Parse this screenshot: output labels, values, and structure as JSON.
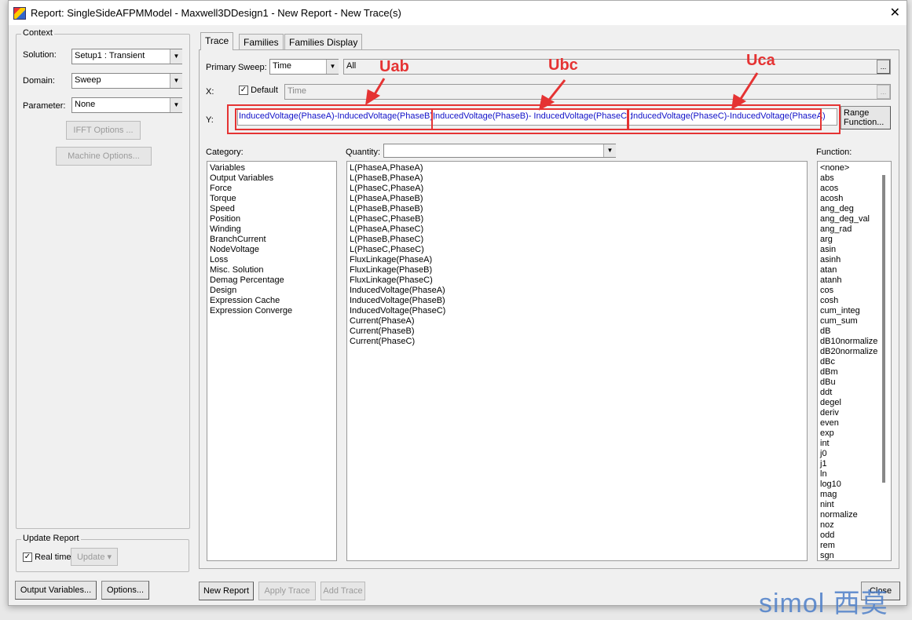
{
  "window": {
    "title": "Report: SingleSideAFPMModel - Maxwell3DDesign1 - New Report - New Trace(s)",
    "close": "✕"
  },
  "context": {
    "legend": "Context",
    "solution_label": "Solution:",
    "solution": "Setup1 : Transient",
    "domain_label": "Domain:",
    "domain": "Sweep",
    "parameter_label": "Parameter:",
    "parameter": "None",
    "ifft": "IFFT Options ...",
    "machine": "Machine Options..."
  },
  "update": {
    "legend": "Update Report",
    "realtime": "Real time",
    "update_btn": "Update"
  },
  "tabs": [
    "Trace",
    "Families",
    "Families Display"
  ],
  "trace": {
    "primary_sweep_label": "Primary Sweep:",
    "primary_sweep": "Time",
    "sweep_values": "All",
    "x_label": "X:",
    "default_label": "Default",
    "x_value": "Time",
    "y_label": "Y:",
    "y_values": [
      "InducedVoltage(PhaseA)-InducedVoltage(PhaseB);",
      "InducedVoltage(PhaseB)- InducedVoltage(PhaseC);",
      "InducedVoltage(PhaseC)-InducedVoltage(PhaseA)"
    ],
    "range_function": "Range Function...",
    "ellipsis": "..."
  },
  "annotations": [
    "Uab",
    "Ubc",
    "Uca"
  ],
  "category": {
    "label": "Category:",
    "items": [
      "Variables",
      "Output Variables",
      "Force",
      "Torque",
      "Speed",
      "Position",
      "Winding",
      "BranchCurrent",
      "NodeVoltage",
      "Loss",
      "Misc. Solution",
      "Demag Percentage",
      "Design",
      "Expression Cache",
      "Expression Converge"
    ]
  },
  "quantity": {
    "label": "Quantity:",
    "filter": "",
    "items": [
      "L(PhaseA,PhaseA)",
      "L(PhaseB,PhaseA)",
      "L(PhaseC,PhaseA)",
      "L(PhaseA,PhaseB)",
      "L(PhaseB,PhaseB)",
      "L(PhaseC,PhaseB)",
      "L(PhaseA,PhaseC)",
      "L(PhaseB,PhaseC)",
      "L(PhaseC,PhaseC)",
      "FluxLinkage(PhaseA)",
      "FluxLinkage(PhaseB)",
      "FluxLinkage(PhaseC)",
      "InducedVoltage(PhaseA)",
      "InducedVoltage(PhaseB)",
      "InducedVoltage(PhaseC)",
      "Current(PhaseA)",
      "Current(PhaseB)",
      "Current(PhaseC)"
    ]
  },
  "function": {
    "label": "Function:",
    "items": [
      "<none>",
      "abs",
      "acos",
      "acosh",
      "ang_deg",
      "ang_deg_val",
      "ang_rad",
      "arg",
      "asin",
      "asinh",
      "atan",
      "atanh",
      "cos",
      "cosh",
      "cum_integ",
      "cum_sum",
      "dB",
      "dB10normalize",
      "dB20normalize",
      "dBc",
      "dBm",
      "dBu",
      "ddt",
      "degel",
      "deriv",
      "even",
      "exp",
      "int",
      "j0",
      "j1",
      "ln",
      "log10",
      "mag",
      "nint",
      "normalize",
      "noz",
      "odd",
      "rem",
      "sgn"
    ]
  },
  "buttons": {
    "output_variables": "Output Variables...",
    "options": "Options...",
    "new_report": "New Report",
    "apply_trace": "Apply Trace",
    "add_trace": "Add Trace",
    "close": "Close"
  },
  "watermark": "simol 西莫",
  "colors": {
    "annotation": "#e53333",
    "y_text": "#1010c8"
  }
}
